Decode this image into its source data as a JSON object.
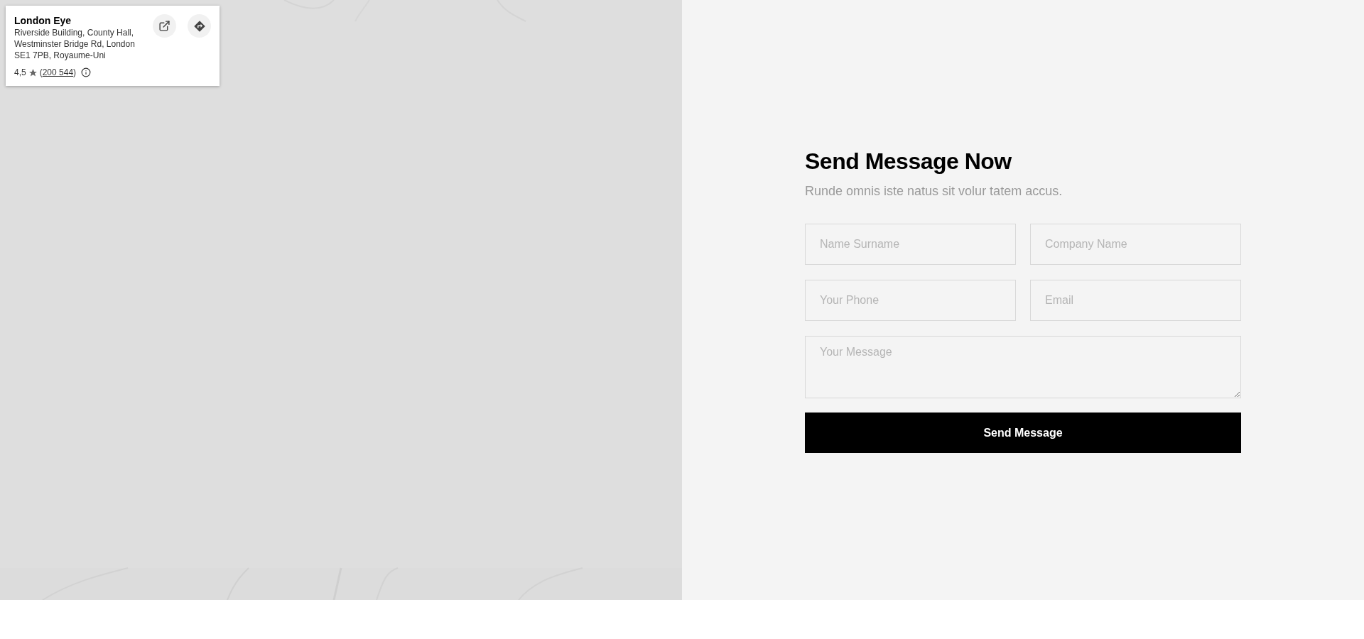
{
  "map": {
    "kind": "picture",
    "place_card": {
      "title": "London Eye",
      "address": "Riverside Building, County Hall, Westminster Bridge Rd, London SE1 7PB, Royaume-Uni",
      "rating": "4,5",
      "paren_open": "(",
      "reviews": "200 544",
      "paren_close": ")"
    }
  },
  "form": {
    "title": "Send Message Now",
    "subtitle": "Runde omnis iste natus sit volur tatem accus.",
    "fields": [
      {
        "kind": "input",
        "placeholder": "Name Surname"
      },
      {
        "kind": "input",
        "placeholder": "Company Name"
      },
      {
        "kind": "input",
        "placeholder": "Your Phone"
      },
      {
        "kind": "input",
        "placeholder": "Email"
      },
      {
        "kind": "textarea",
        "placeholder": "Your Message"
      }
    ],
    "submit": "Send Message"
  }
}
